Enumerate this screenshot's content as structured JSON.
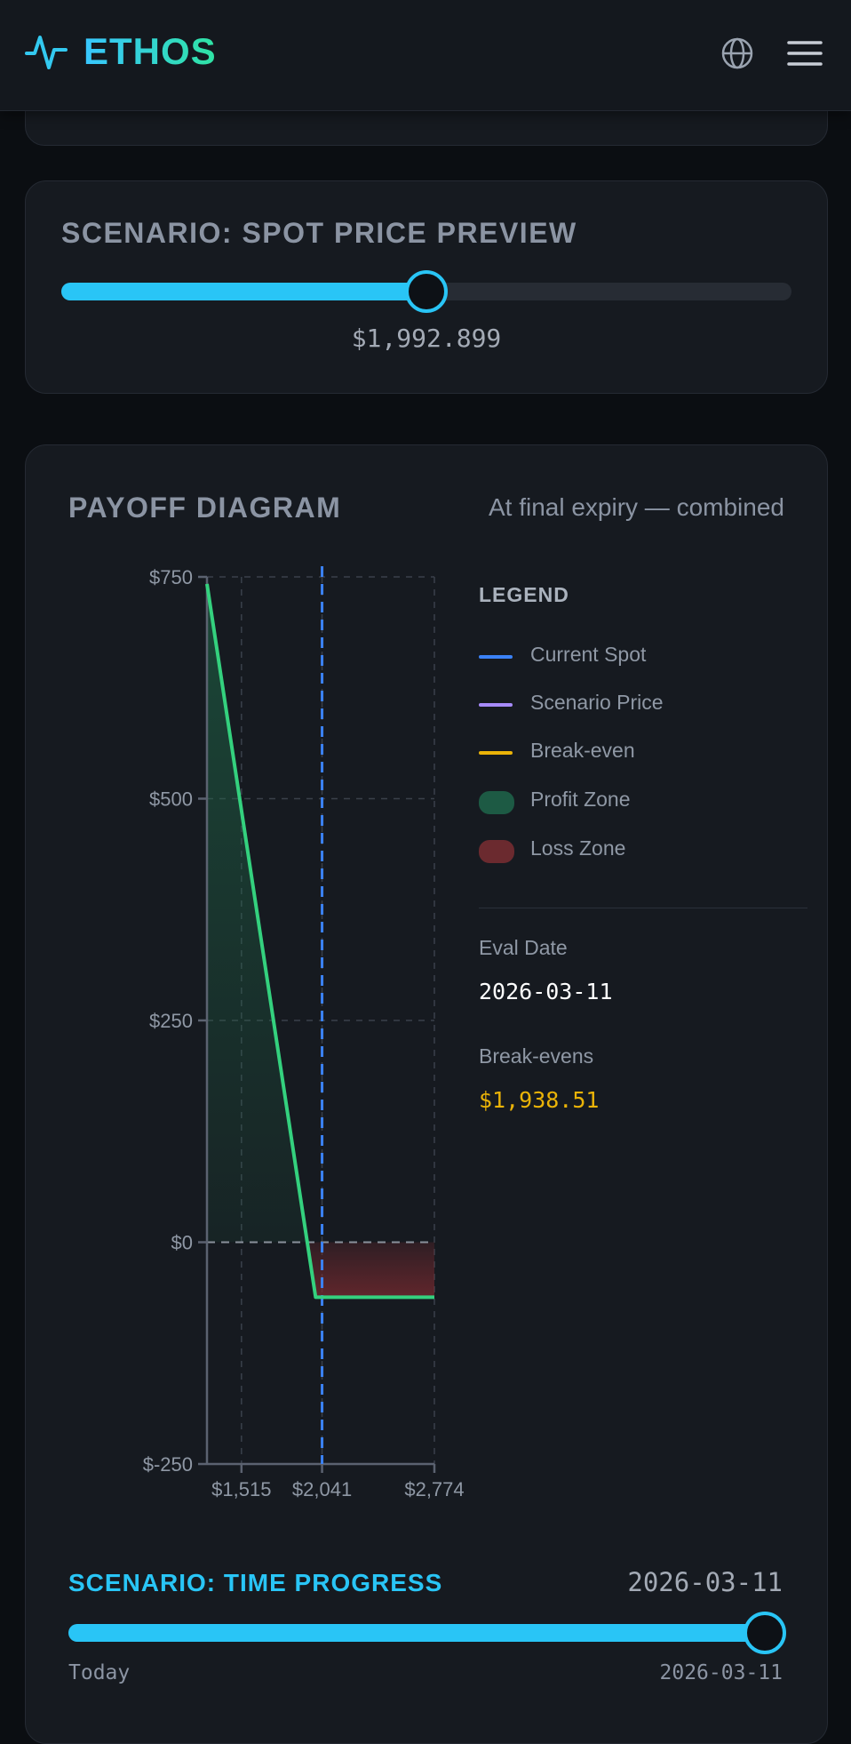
{
  "header": {
    "brand": "ETHOS",
    "brand_icon": "pulse-icon",
    "language_icon": "globe-icon",
    "menu_icon": "hamburger-menu-icon"
  },
  "spot_preview": {
    "title": "SCENARIO: SPOT PRICE PREVIEW",
    "value_label": "$1,992.899",
    "fraction": 0.5
  },
  "payoff": {
    "title": "PAYOFF DIAGRAM",
    "subtitle": "At final expiry — combined",
    "legend": {
      "title": "LEGEND",
      "items": [
        {
          "label": "Current Spot",
          "color": "#3b82f6",
          "kind": "line"
        },
        {
          "label": "Scenario Price",
          "color": "#a78bfa",
          "kind": "line"
        },
        {
          "label": "Break-even",
          "color": "#eab308",
          "kind": "line"
        },
        {
          "label": "Profit Zone",
          "color": "#1d5a44",
          "kind": "zone"
        },
        {
          "label": "Loss Zone",
          "color": "#6b2a2f",
          "kind": "zone"
        }
      ]
    },
    "eval_date_label": "Eval Date",
    "eval_date": "2026-03-11",
    "breakevens_label": "Break-evens",
    "breakevens": "$1,938.51"
  },
  "chart_data": {
    "type": "line",
    "title": "PAYOFF DIAGRAM",
    "subtitle": "At final expiry — combined",
    "xlabel": "",
    "ylabel": "",
    "x_ticks": [
      "$1,515",
      "$2,041",
      "$2,774"
    ],
    "y_ticks": [
      "$750",
      "$500",
      "$250",
      "$0",
      "$-250"
    ],
    "xlim": [
      1290,
      2774
    ],
    "ylim": [
      -250,
      750
    ],
    "grid": true,
    "series": [
      {
        "color": "#34d17e",
        "x": [
          1290,
          1999,
          2774
        ],
        "y": [
          742,
          -62,
          -62
        ]
      }
    ],
    "current_spot": 2041,
    "break_even": 1938.51,
    "axis_color": "#5b6270",
    "profit_color": "#1f6b4a",
    "loss_color": "#7a2a30"
  },
  "time_progress": {
    "title": "SCENARIO: TIME PROGRESS",
    "current_date": "2026-03-11",
    "start_label": "Today",
    "end_label": "2026-03-11",
    "fraction": 1.0
  }
}
